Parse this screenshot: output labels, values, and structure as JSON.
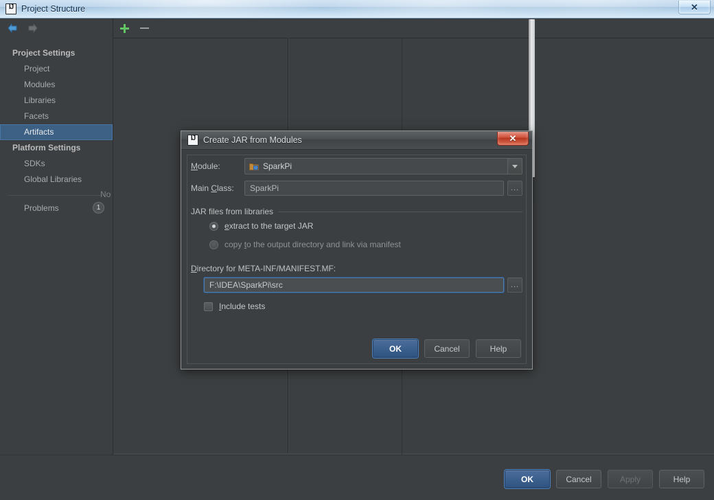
{
  "window": {
    "title": "Project Structure",
    "logo_icon": "intellij-idea-logo-icon",
    "close_icon": "close-icon",
    "close_glyph": "✕"
  },
  "sidebar": {
    "back_icon": "back-arrow-icon",
    "forward_icon": "forward-arrow-icon",
    "groups": [
      {
        "label": "Project Settings",
        "items": [
          {
            "label": "Project",
            "selected": false
          },
          {
            "label": "Modules",
            "selected": false
          },
          {
            "label": "Libraries",
            "selected": false
          },
          {
            "label": "Facets",
            "selected": false
          },
          {
            "label": "Artifacts",
            "selected": true
          }
        ]
      },
      {
        "label": "Platform Settings",
        "items": [
          {
            "label": "SDKs",
            "selected": false
          },
          {
            "label": "Global Libraries",
            "selected": false
          }
        ]
      }
    ],
    "problems": {
      "label": "Problems",
      "count": "1"
    }
  },
  "toolbar": {
    "add_icon": "plus-icon",
    "remove_icon": "minus-icon"
  },
  "content": {
    "empty_text": "No"
  },
  "dialog": {
    "title": "Create JAR from Modules",
    "logo_icon": "intellij-idea-logo-icon",
    "close_icon": "close-icon",
    "close_glyph": "✕",
    "module": {
      "label": "Module:",
      "label_mnemonic": "M",
      "label_rest": "odule:",
      "value": "SparkPi",
      "icon": "module-folder-icon",
      "dropdown_icon": "chevron-down-icon"
    },
    "main_class": {
      "label_pre": "Main ",
      "label_mnemonic": "C",
      "label_rest": "lass:",
      "value": "SparkPi",
      "browse_label": "...",
      "browse_icon": "ellipsis-browse-icon"
    },
    "jar_group": {
      "title": "JAR files from libraries",
      "options": [
        {
          "mnemonic": "e",
          "pre": "",
          "rest": "xtract to the target JAR",
          "full_label": "extract to the target JAR",
          "selected": true
        },
        {
          "mnemonic": "t",
          "pre": "copy ",
          "rest": "o the output directory and link via manifest",
          "full_label": "copy to the output directory and link via manifest",
          "selected": false
        }
      ]
    },
    "directory": {
      "label_mnemonic": "D",
      "label_rest": "irectory for META-INF/MANIFEST.MF:",
      "full_label": "Directory for META-INF/MANIFEST.MF:",
      "value": "F:\\IDEA\\SparkPi\\src",
      "browse_label": "...",
      "browse_icon": "ellipsis-browse-icon"
    },
    "include_tests": {
      "label_mnemonic": "I",
      "label_rest": "nclude tests",
      "full_label": "Include tests",
      "checked": false
    },
    "buttons": {
      "ok": "OK",
      "cancel": "Cancel",
      "help": "Help"
    }
  },
  "bottom_buttons": {
    "ok": "OK",
    "cancel": "Cancel",
    "apply": "Apply",
    "help": "Help"
  },
  "colors": {
    "window_bg": "#3c3f41",
    "panel_bg": "#45484a",
    "selection_blue": "#3d6185",
    "primary_button": "#2f5380",
    "close_red": "#c7452c",
    "add_green": "#62c462"
  }
}
